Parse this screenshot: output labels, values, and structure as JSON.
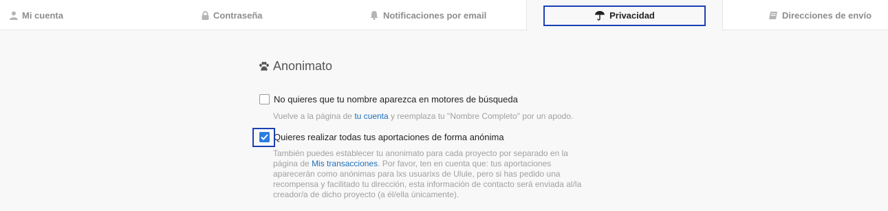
{
  "tabs": [
    {
      "label": "Mi cuenta",
      "icon": "user-icon"
    },
    {
      "label": "Contraseña",
      "icon": "lock-icon"
    },
    {
      "label": "Notificaciones por email",
      "icon": "bell-icon"
    },
    {
      "label": "Privacidad",
      "icon": "umbrella-icon",
      "active": true
    },
    {
      "label": "Direcciones de envío",
      "icon": "book-icon"
    }
  ],
  "section": {
    "title": "Anonimato",
    "icon": "paw-icon"
  },
  "options": [
    {
      "label": "No quieres que tu nombre aparezca en motores de búsqueda",
      "checked": false,
      "help_pre": "Vuelve a la página de ",
      "help_link": "tu cuenta",
      "help_post": " y reemplaza tu \"Nombre Completo\" por un apodo."
    },
    {
      "label": "Quieres realizar todas tus aportaciones de forma anónima",
      "checked": true,
      "help_line1": "También puedes establecer tu anonimato para cada proyecto por separado en la",
      "help_pre": "página de ",
      "help_link": "Mis transacciones",
      "help_post": ". Por favor, ten en cuenta que: tus aportaciones",
      "help_line3": "aparecerán como anónimas para lxs usuarixs de Ulule, pero si has pedido una",
      "help_line4": "recompensa y facilitado tu dirección, esta información de contacto será enviada al/la",
      "help_line5": "creador/a de dicho proyecto (a él/ella únicamente)."
    }
  ],
  "colors": {
    "accent": "#1f6fb8",
    "checkbox_checked": "#2a7de1",
    "focus_ring": "#1b3fb3"
  }
}
